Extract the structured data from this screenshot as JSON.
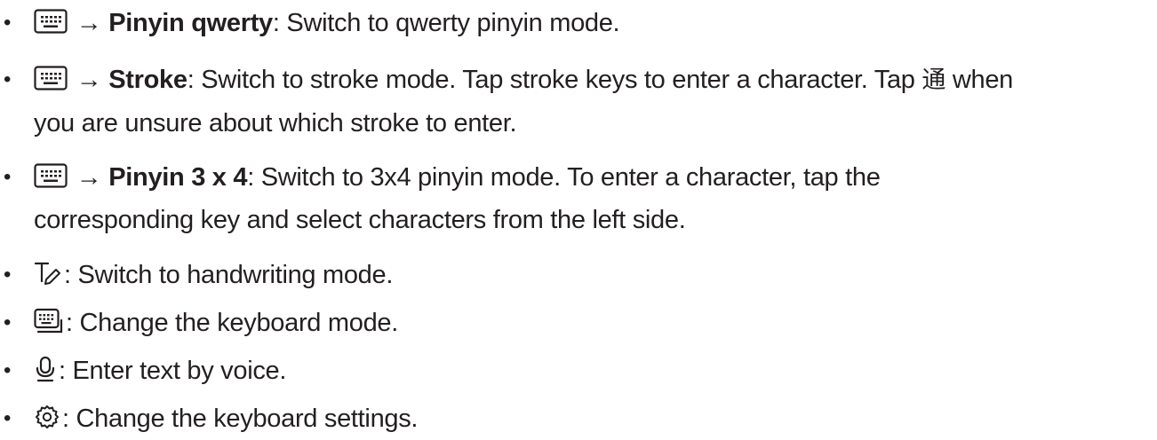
{
  "items": [
    {
      "arrow": "→",
      "term": "Pinyin qwerty",
      "desc": ": Switch to qwerty pinyin mode."
    },
    {
      "arrow": "→",
      "term": "Stroke",
      "desc_a": ": Switch to stroke mode. Tap stroke keys to enter a character. Tap",
      "glyph": "通",
      "desc_b": "when",
      "desc_line2": "you are unsure about which stroke to enter."
    },
    {
      "arrow": "→",
      "term": "Pinyin 3 x 4",
      "desc": ": Switch to 3x4 pinyin mode. To enter a character, tap the",
      "desc_line2": "corresponding key and select characters from the left side."
    },
    {
      "desc": ": Switch to handwriting mode."
    },
    {
      "desc": ": Change the keyboard mode."
    },
    {
      "desc": ": Enter text by voice."
    },
    {
      "desc": ": Change the keyboard settings."
    }
  ],
  "icons": [
    "keyboard-icon",
    "keyboard-icon",
    "keyboard-icon",
    "handwriting-icon",
    "keyboard-mode-icon",
    "microphone-icon",
    "gear-icon"
  ],
  "colors": {
    "text": "#231f20",
    "background": "#ffffff"
  }
}
